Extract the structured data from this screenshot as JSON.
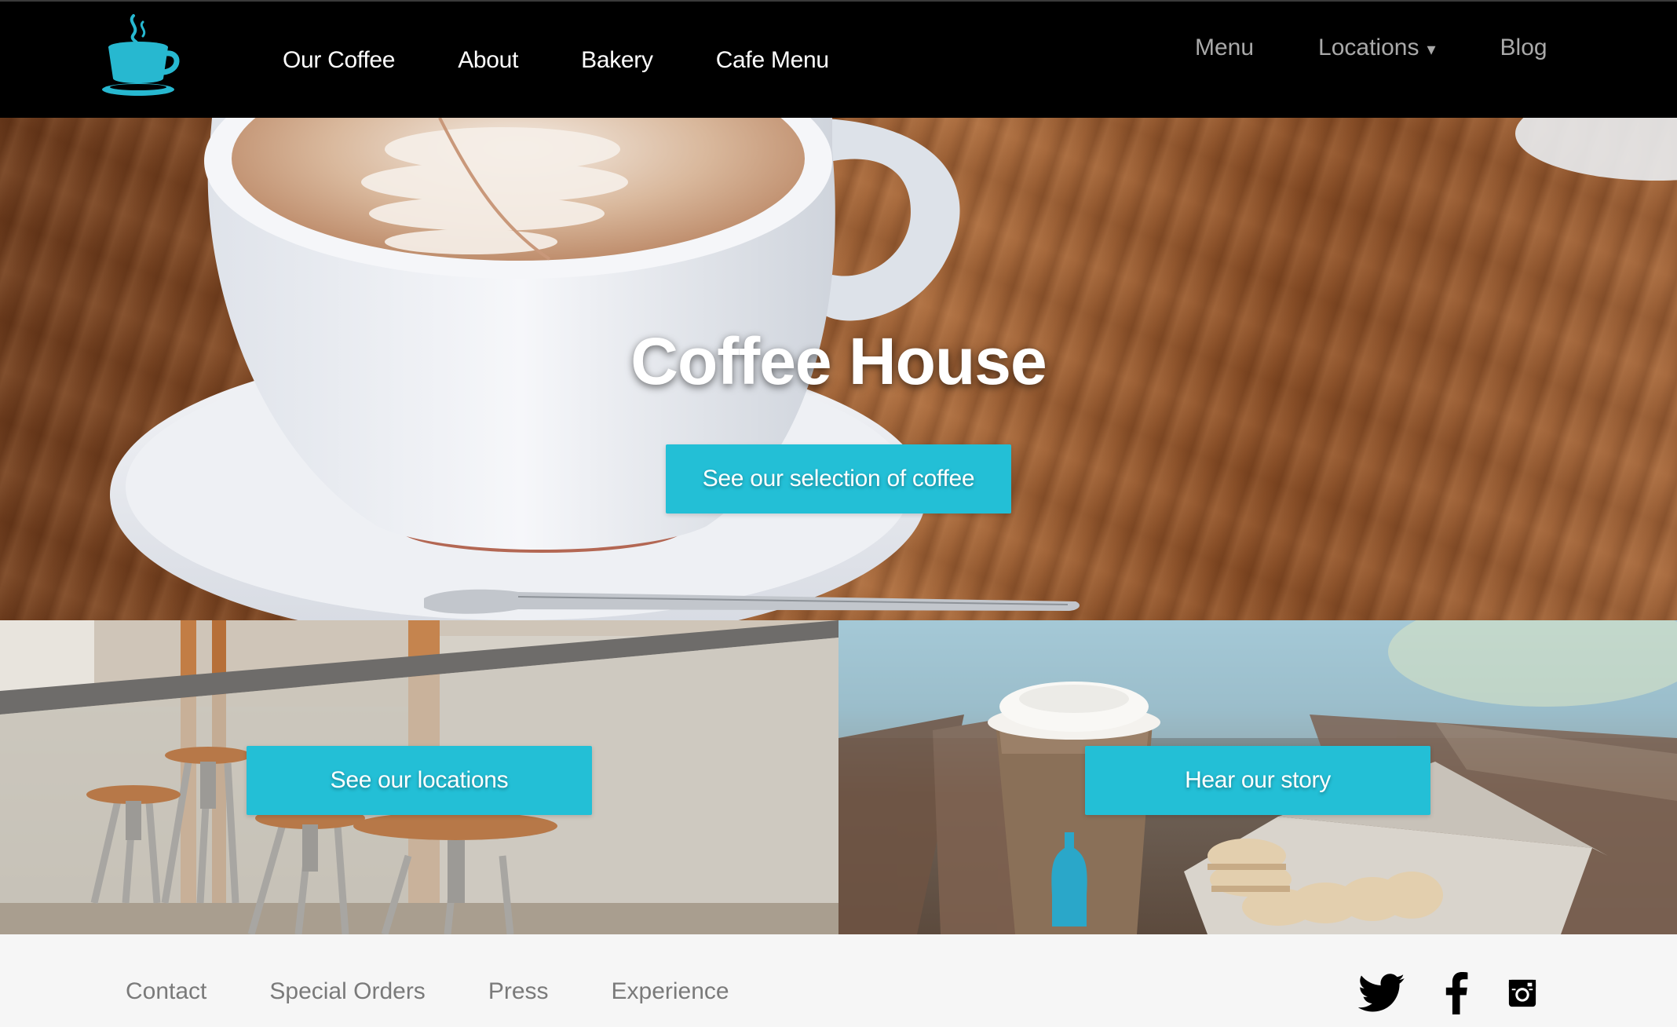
{
  "brand": {
    "logo_icon": "coffee-cup-icon",
    "accent_color": "#23bfd6"
  },
  "header": {
    "primary_nav": [
      "Our Coffee",
      "About",
      "Bakery",
      "Cafe Menu"
    ],
    "secondary_nav": {
      "menu": "Menu",
      "locations": "Locations",
      "locations_caret": "▾",
      "blog": "Blog"
    }
  },
  "hero": {
    "title": "Coffee House",
    "cta_label": "See our selection of coffee"
  },
  "tiles": {
    "locations_cta": "See our locations",
    "story_cta": "Hear our story"
  },
  "footer": {
    "links": [
      "Contact",
      "Special Orders",
      "Press",
      "Experience"
    ],
    "social_icons": [
      "twitter-icon",
      "facebook-icon",
      "instagram-icon"
    ]
  }
}
